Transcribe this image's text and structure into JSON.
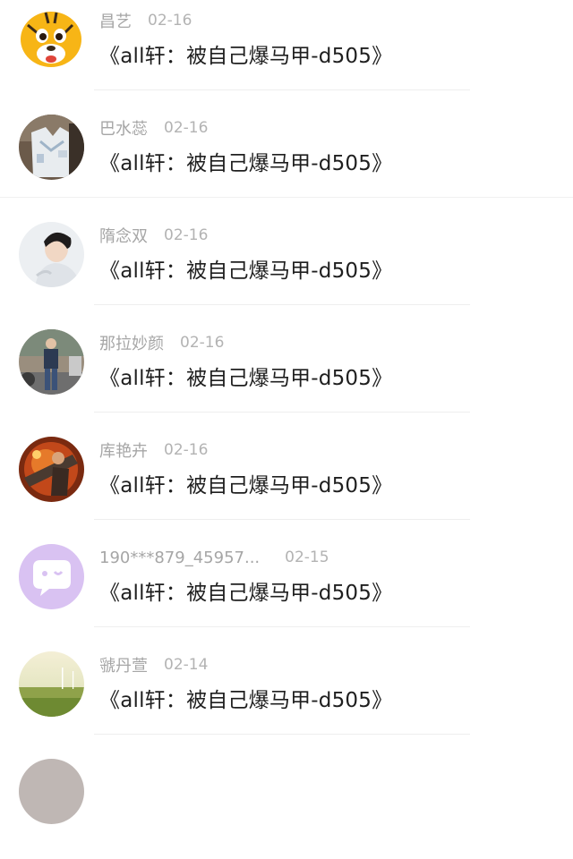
{
  "comments": [
    {
      "user": "昌艺",
      "date": "02-16",
      "text": "《all轩：被自己爆马甲-d505》",
      "avatar": "tiger-cartoon-avatar"
    },
    {
      "user": "巴水蕊",
      "date": "02-16",
      "text": "《all轩：被自己爆马甲-d505》",
      "avatar": "clothes-photo-avatar"
    },
    {
      "user": "隋念双",
      "date": "02-16",
      "text": "《all轩：被自己爆马甲-d505》",
      "avatar": "boy-portrait-avatar"
    },
    {
      "user": "那拉妙颜",
      "date": "02-16",
      "text": "《all轩：被自己爆马甲-d505》",
      "avatar": "street-person-avatar"
    },
    {
      "user": "库艳卉",
      "date": "02-16",
      "text": "《all轩：被自己爆马甲-d505》",
      "avatar": "game-character-avatar"
    },
    {
      "user": "190***879_45957...",
      "date": "02-15",
      "text": "《all轩：被自己爆马甲-d505》",
      "avatar": "default-chat-avatar"
    },
    {
      "user": "虢丹萱",
      "date": "02-14",
      "text": "《all轩：被自己爆马甲-d505》",
      "avatar": "landscape-avatar"
    }
  ],
  "colors": {
    "username": "#a6a6a6",
    "date": "#b3b3b3",
    "comment_text": "#1f1f1f",
    "divider": "#eeeeee",
    "default_avatar_bg": "#d9c2f2"
  }
}
